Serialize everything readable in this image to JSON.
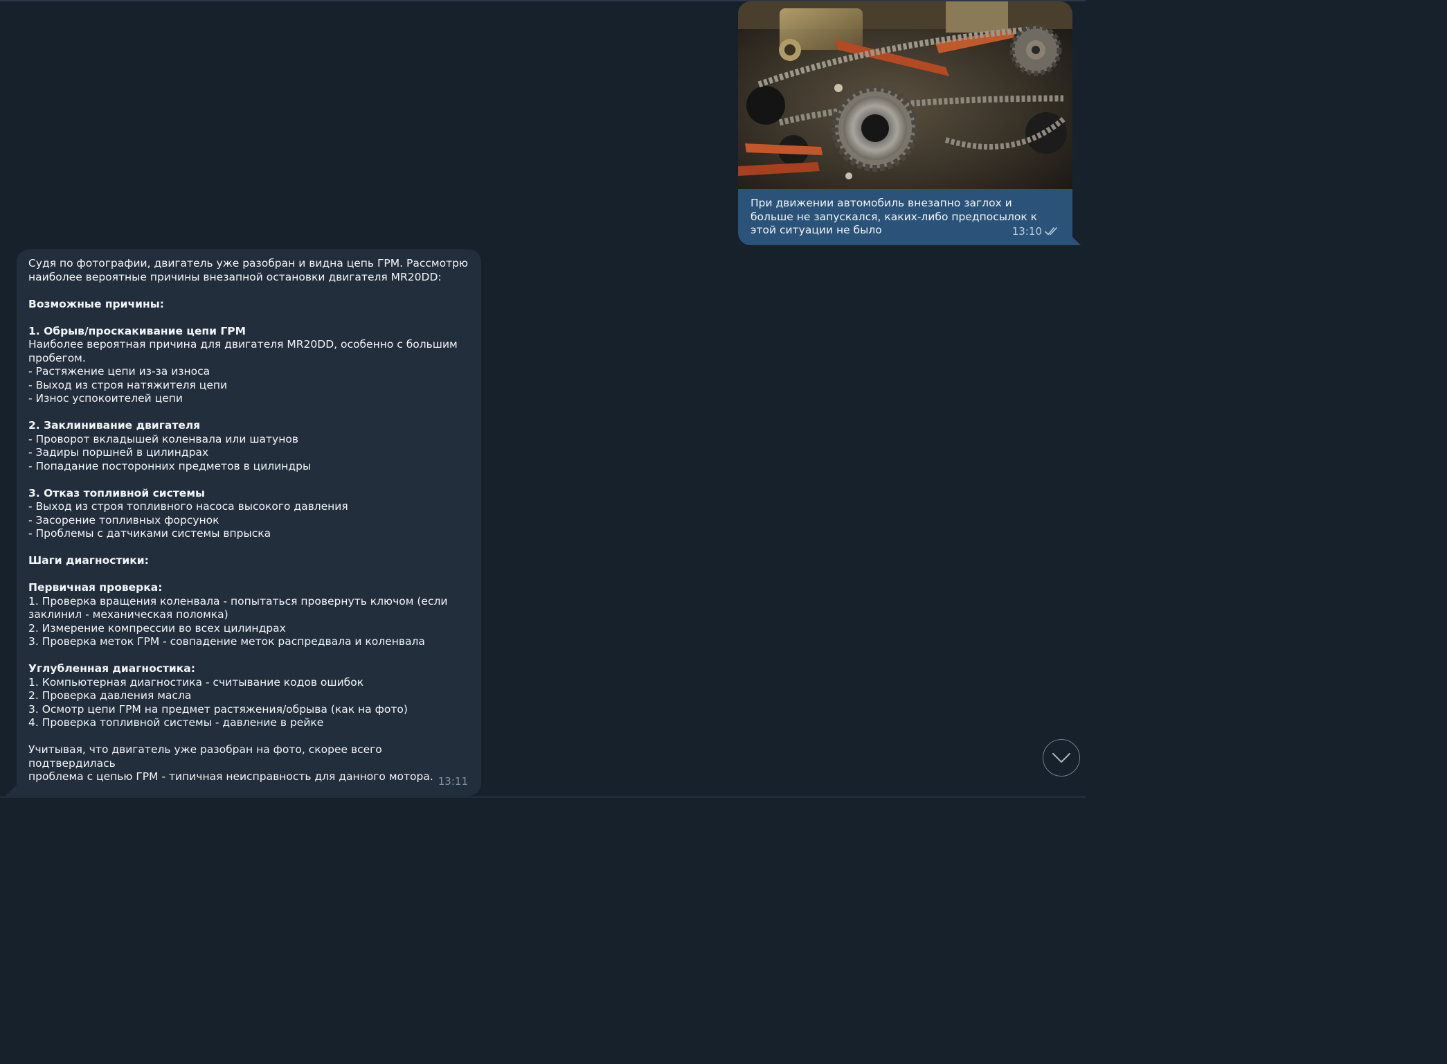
{
  "outgoing": {
    "photo_icon": "engine-timing-chain-photo",
    "text_lines": [
      "При движении автомобиль внезапно заглох и",
      "больше не запускался, каких-либо предпосылок к",
      "этой ситуации не было"
    ],
    "time": "13:10",
    "status_icon": "double-check-icon"
  },
  "incoming": {
    "time": "13:11",
    "blocks": [
      {
        "lines": [
          "Судя по фотографии, двигатель уже разобран и видна цепь ГРМ. Рассмотрю",
          "наиболее вероятные причины внезапной остановки двигателя MR20DD:"
        ]
      },
      {
        "heading": "Возможные причины:"
      },
      {
        "heading": "1. Обрыв/проскакивание цепи ГРМ",
        "lines": [
          "Наиболее вероятная причина для двигателя MR20DD, особенно с большим",
          "пробегом.",
          "- Растяжение цепи из-за износа",
          "- Выход из строя натяжителя цепи",
          "- Износ успокоителей цепи"
        ]
      },
      {
        "heading": "2. Заклинивание двигателя",
        "lines": [
          "- Проворот вкладышей коленвала или шатунов",
          "- Задиры поршней в цилиндрах",
          "- Попадание посторонних предметов в цилиндры"
        ]
      },
      {
        "heading": "3. Отказ топливной системы",
        "lines": [
          "- Выход из строя топливного насоса высокого давления",
          "- Засорение топливных форсунок",
          "- Проблемы с датчиками системы впрыска"
        ]
      },
      {
        "heading": "Шаги диагностики:"
      },
      {
        "heading": "Первичная проверка:",
        "lines": [
          "1. Проверка вращения коленвала - попытаться провернуть ключом (если",
          "заклинил - механическая поломка)",
          "2. Измерение компрессии во всех цилиндрах",
          "3. Проверка меток ГРМ - совпадение меток распредвала и коленвала"
        ]
      },
      {
        "heading": "Углубленная диагностика:",
        "lines": [
          "1. Компьютерная диагностика - считывание кодов ошибок",
          "2. Проверка давления масла",
          "3. Осмотр цепи ГРМ на предмет растяжения/обрыва (как на фото)",
          "4. Проверка топливной системы - давление в рейке"
        ]
      },
      {
        "lines": [
          "Учитывая, что двигатель уже разобран на фото, скорее всего подтвердилась",
          "проблема с цепью ГРМ - типичная неисправность для данного мотора."
        ]
      }
    ]
  },
  "scroll_button_icon": "chevron-down-icon",
  "colors": {
    "background": "#17212b",
    "outgoing_bubble": "#2b5278",
    "incoming_bubble": "#232e3c",
    "text": "#f2f5f8",
    "meta_outgoing": "#b9cde0",
    "meta_incoming": "#7f91a4"
  }
}
